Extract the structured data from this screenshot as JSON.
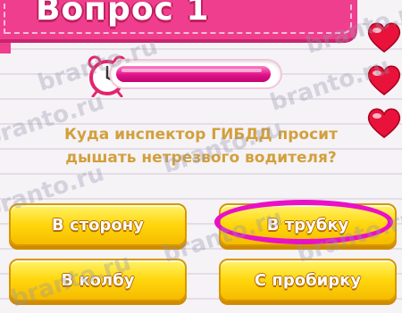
{
  "header": {
    "title": "Вопрос 1"
  },
  "timer": {
    "progress_fraction": 0.97,
    "icon": "alarm-clock-icon"
  },
  "lives": {
    "count": 3,
    "icon": "heart-icon",
    "color": "#e8123a"
  },
  "question": {
    "line1": "Куда инспектор ГИБДД просит",
    "line2": "дышать нетрезвого водителя?"
  },
  "answers": [
    {
      "label": "В сторону"
    },
    {
      "label": "В трубку",
      "highlighted": true
    },
    {
      "label": "В колбу"
    },
    {
      "label": "С пробирку"
    }
  ],
  "watermark": {
    "text": "branto.ru"
  },
  "colors": {
    "header": "#f03e8e",
    "answer_button": "#ffd60c",
    "highlight_ring": "#e810c8",
    "question_text": "#d2a03c"
  }
}
